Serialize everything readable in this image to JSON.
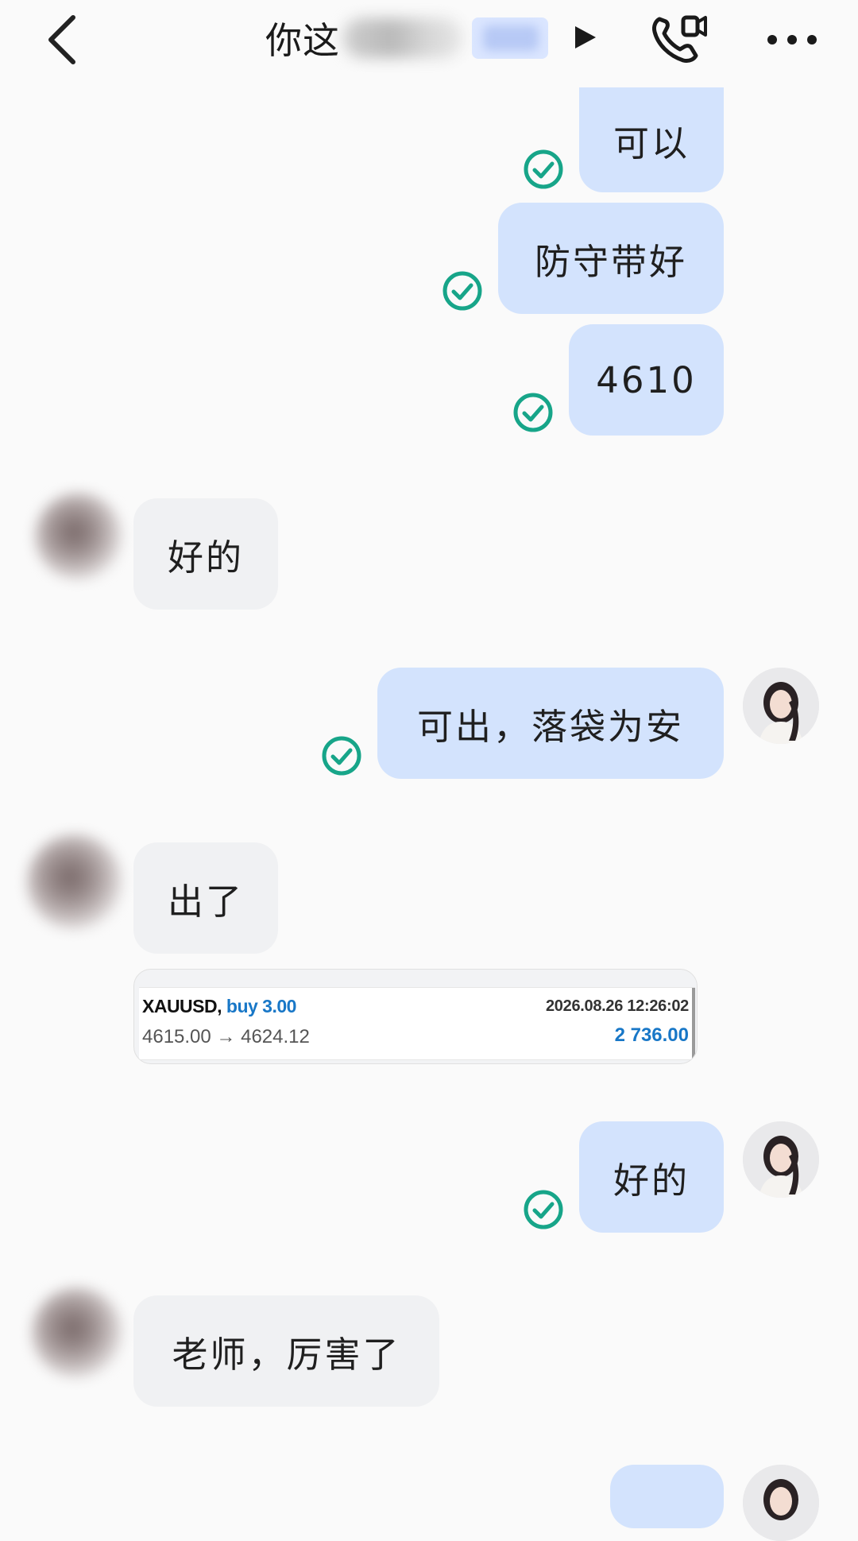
{
  "header": {
    "title_visible": "你这",
    "icons": [
      "back-icon",
      "play-icon",
      "video-call-icon",
      "more-icon"
    ]
  },
  "messages": {
    "m1": "可以",
    "m2": "防守带好",
    "m3": "4610",
    "m4": "好的",
    "m5": "可出，落袋为安",
    "m6": "出了",
    "m7": "好的",
    "m8": "老师，厉害了"
  },
  "trade": {
    "symbol": "XAUUSD,",
    "action": "buy 3.00",
    "datetime": "2026.08.26 12:26:02",
    "prices": "4615.00 → 4624.12",
    "profit": "2 736.00"
  },
  "colors": {
    "outgoing_bubble": "#d3e3fd",
    "incoming_bubble": "#f0f1f3",
    "read_check": "#17a589",
    "trade_accent": "#1877c7"
  }
}
